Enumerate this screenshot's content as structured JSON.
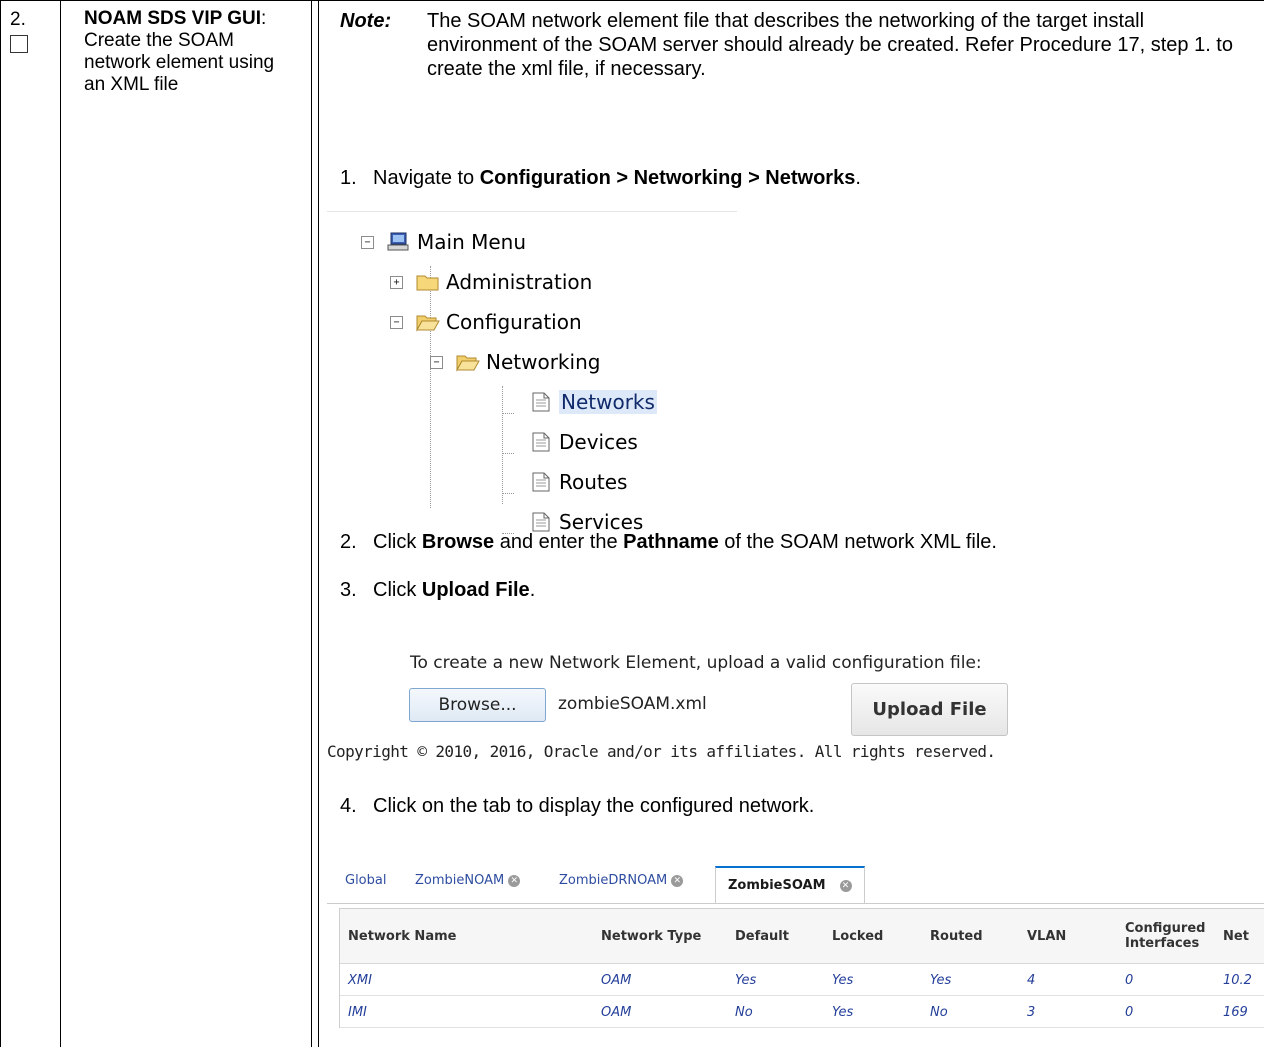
{
  "step": {
    "number": "2.",
    "title_bold": "NOAM SDS VIP GUI",
    "title_rest": ": Create the SOAM network element using an XML file"
  },
  "note": {
    "label": "Note:",
    "text": "The SOAM network element file that describes the networking of the target install environment of the SOAM server should already be created.  Refer Procedure 17, step 1. to create the xml file, if necessary."
  },
  "instructions": {
    "s1": {
      "num": "1.",
      "pre": "Navigate to ",
      "bold": "Configuration > Networking > Networks",
      "post": "."
    },
    "s2": {
      "num": "2.",
      "pre": "Click ",
      "bold1": "Browse",
      "mid": " and enter the ",
      "bold2": "Pathname",
      "post": " of the SOAM network XML file."
    },
    "s3": {
      "num": "3.",
      "pre": "Click ",
      "bold": "Upload File",
      "post": "."
    },
    "s4": {
      "num": "4.",
      "text": "Click on the tab to display the configured network."
    }
  },
  "tree": {
    "root": "Main Menu",
    "administration": "Administration",
    "configuration": "Configuration",
    "networking": "Networking",
    "networks": "Networks",
    "devices": "Devices",
    "routes": "Routes",
    "services": "Services"
  },
  "upload": {
    "instruction": "To create a new Network Element, upload a valid configuration file:",
    "browse_label": "Browse...",
    "filename": "zombieSOAM.xml",
    "upload_label": "Upload File",
    "copyright": "Copyright © 2010, 2016, Oracle and/or its affiliates. All rights reserved."
  },
  "tabs": {
    "global": "Global",
    "noam": "ZombieNOAM",
    "drnoam": "ZombieDRNOAM",
    "soam": "ZombieSOAM"
  },
  "network_table": {
    "headers": [
      "Network Name",
      "Network Type",
      "Default",
      "Locked",
      "Routed",
      "VLAN",
      "Configured Interfaces",
      "Net"
    ],
    "rows": [
      [
        "XMI",
        "OAM",
        "Yes",
        "Yes",
        "Yes",
        "4",
        "0",
        "10.2"
      ],
      [
        "IMI",
        "OAM",
        "No",
        "Yes",
        "No",
        "3",
        "0",
        "169"
      ]
    ]
  },
  "colors": {
    "link_blue": "#243f9a",
    "active_tab_accent": "#0572ce",
    "selected_item_bg": "#dde8f8"
  }
}
